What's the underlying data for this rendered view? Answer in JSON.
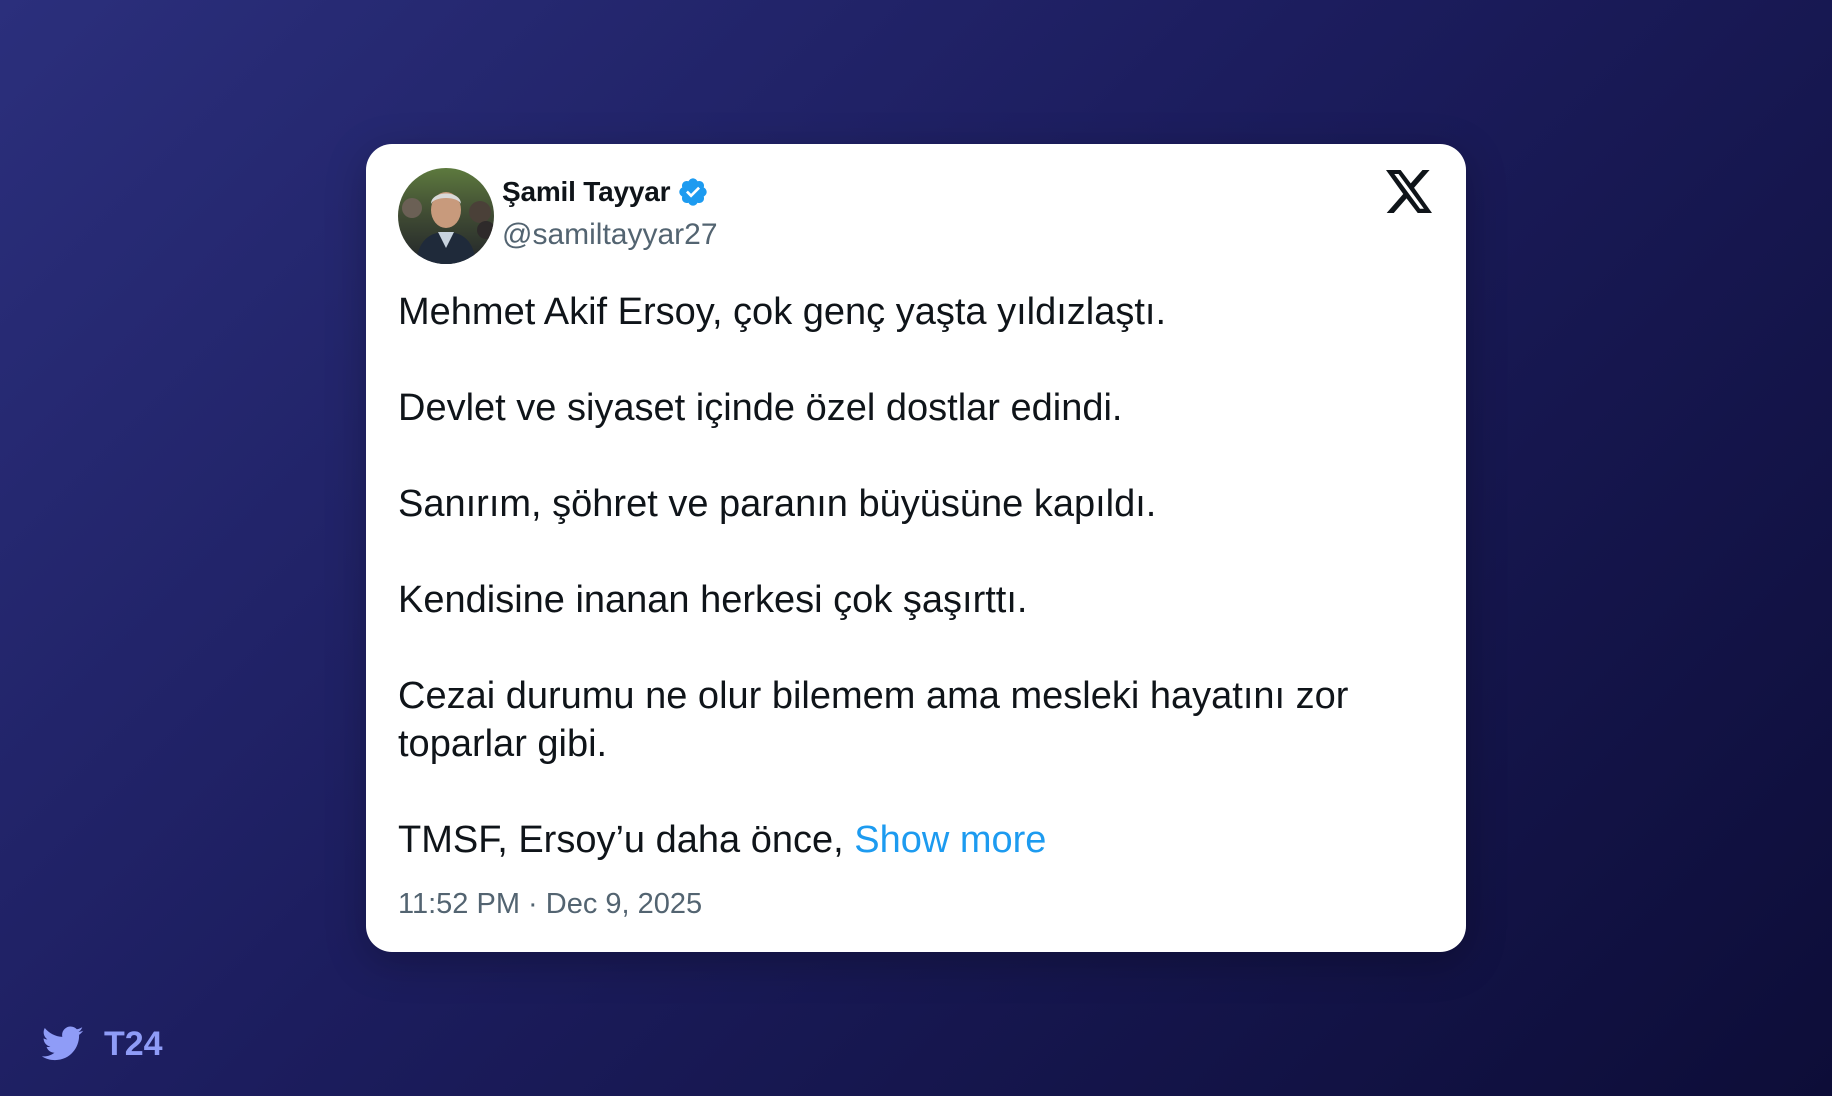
{
  "tweet": {
    "display_name": "Şamil Tayyar",
    "handle": "@samiltayyar27",
    "verified_icon": "verified-badge-icon",
    "platform_icon": "x-logo-icon",
    "paragraphs": [
      "Mehmet Akif Ersoy, çok genç yaşta yıldızlaştı.",
      "Devlet ve siyaset içinde özel dostlar edindi.",
      "Sanırım, şöhret ve paranın büyüsüne kapıldı.",
      "Kendisine inanan herkesi çok şaşırttı.",
      "Cezai durumu ne olur bilemem ama mesleki hayatını zor toparlar gibi."
    ],
    "truncated_text": "TMSF, Ersoy’u daha önce, ",
    "show_more_label": "Show more",
    "timestamp": "11:52 PM · Dec 9, 2025"
  },
  "branding": {
    "icon": "twitter-bird-icon",
    "name": "T24"
  },
  "colors": {
    "accent": "#1d9bf0",
    "text": "#0f1419",
    "muted": "#536471",
    "brand": "#8f9cf7"
  }
}
